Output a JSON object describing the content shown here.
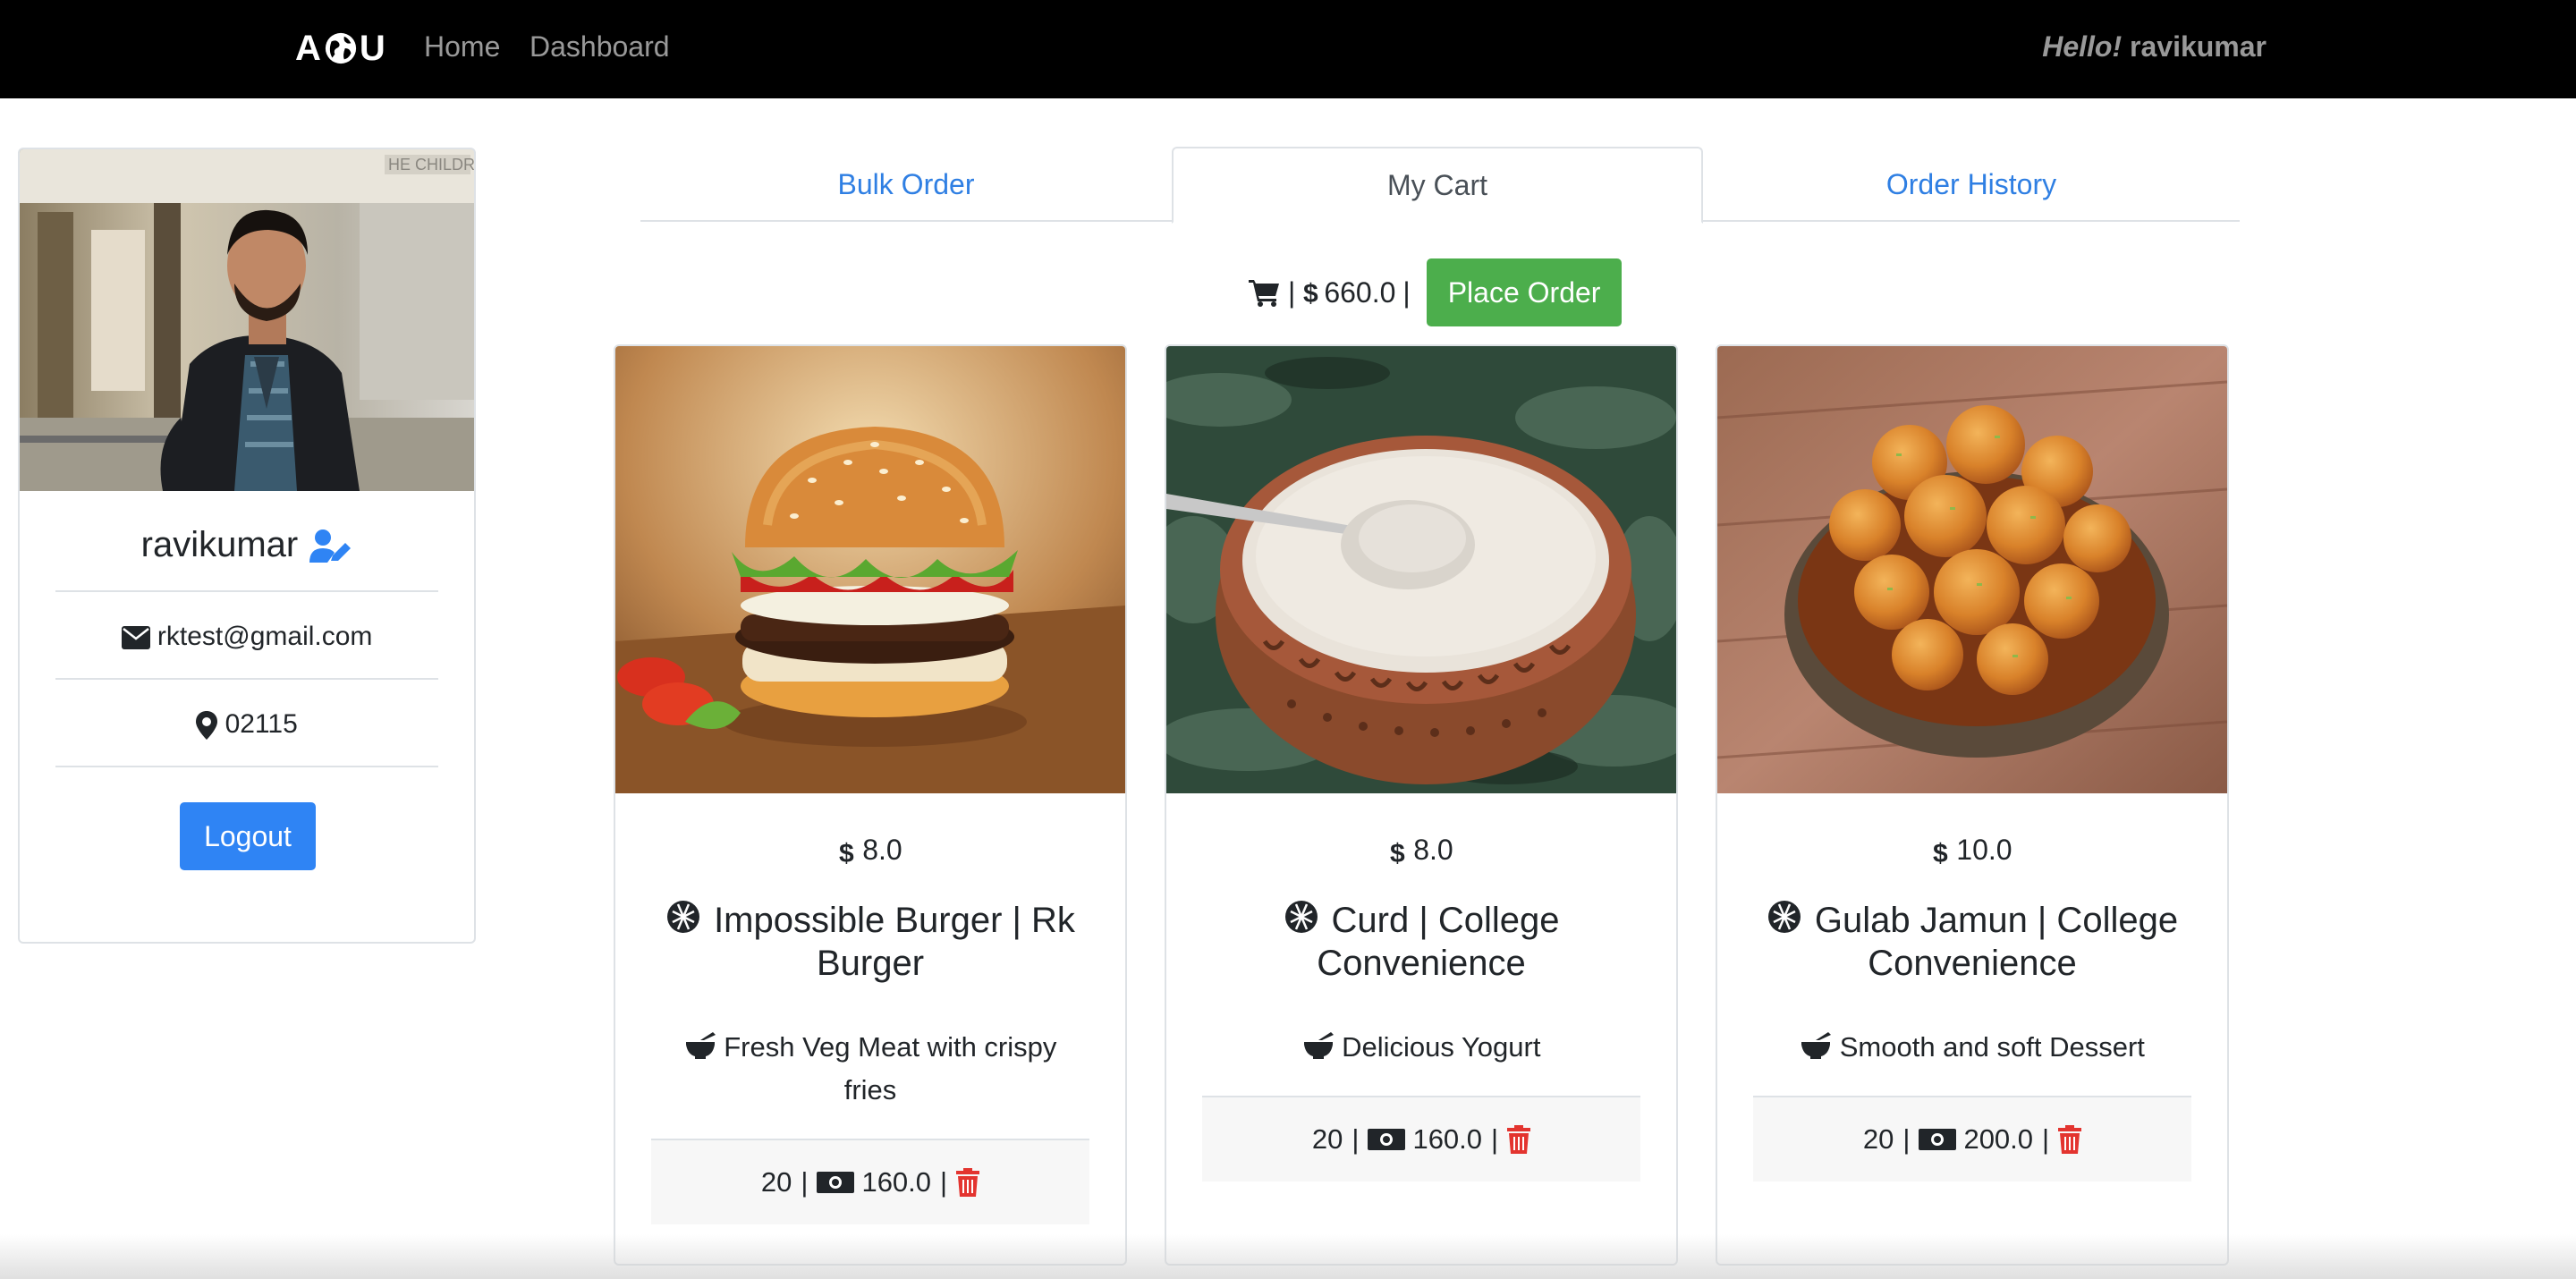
{
  "navbar": {
    "brand": {
      "left": "A",
      "right": "U"
    },
    "links": {
      "home": "Home",
      "dashboard": "Dashboard"
    },
    "greeting": {
      "hello": "Hello!",
      "user": "ravikumar"
    }
  },
  "profile": {
    "name": "ravikumar",
    "email": "rktest@gmail.com",
    "zip": "02115",
    "logout_label": "Logout",
    "photo_sign": "HE CHILDRE"
  },
  "tabs": {
    "bulk": "Bulk Order",
    "cart": "My Cart",
    "history": "Order History",
    "active": "My Cart"
  },
  "cart_summary": {
    "separator": "|",
    "total": "660.0",
    "currency_icon": "dollar-icon",
    "cart_icon": "shopping-cart-icon",
    "place_order_label": "Place Order"
  },
  "items": [
    {
      "price": "8.0",
      "title_line1": "Impossible Burger | Rk",
      "title_line2": "Burger",
      "desc_line1": "Fresh Veg Meat with crispy",
      "desc_line2": "fries",
      "quantity": "20",
      "subtotal": "160.0"
    },
    {
      "price": "8.0",
      "title_line1": "Curd | College",
      "title_line2": "Convenience",
      "desc_line1": "Delicious Yogurt",
      "quantity": "20",
      "subtotal": "160.0"
    },
    {
      "price": "10.0",
      "title_line1": "Gulab Jamun | College",
      "title_line2": "Convenience",
      "desc_line1": "Smooth and soft Dessert",
      "quantity": "20",
      "subtotal": "200.0"
    }
  ],
  "colors": {
    "navbar_bg": "#000000",
    "link_blue": "#2f7fe3",
    "primary_button": "#2f84f4",
    "success_button": "#4cae4c",
    "danger": "#e3342f",
    "footer_bg": "#f7f7f7"
  }
}
